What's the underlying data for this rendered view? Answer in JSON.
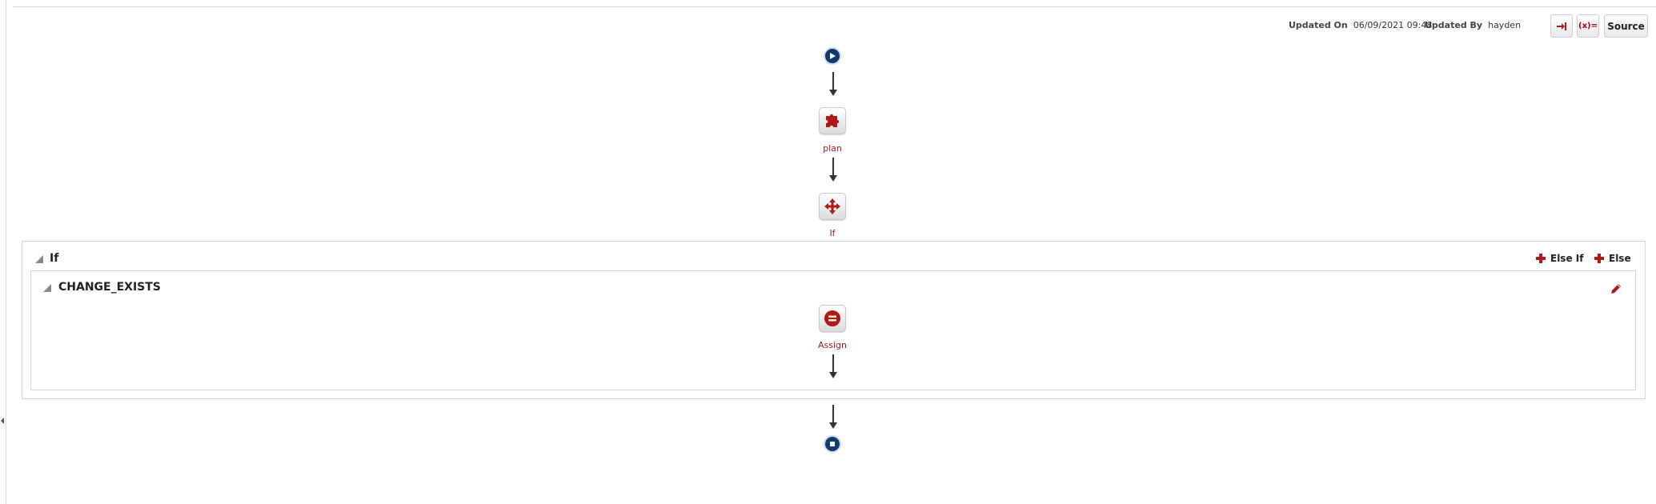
{
  "header": {
    "updated_on_label": "Updated On",
    "updated_on_value": "06/09/2021 09:48",
    "updated_by_label": "Updated By",
    "updated_by_value": "hayden",
    "buttons": {
      "import_icon": "sign-in-icon",
      "variables_label": "(x)=",
      "source_label": "Source"
    }
  },
  "flow": {
    "start_icon": "play-icon",
    "plan_label": "plan",
    "if_label": "If",
    "assign_label": "Assign",
    "end_icon": "stop-icon"
  },
  "if_block": {
    "title": "If",
    "else_if_label": "Else If",
    "else_label": "Else",
    "condition": {
      "title": "CHANGE_EXISTS",
      "edit_icon": "pencil-icon"
    }
  },
  "colors": {
    "accent_red": "#9b1c1c",
    "node_blue": "#0f3b6e"
  }
}
